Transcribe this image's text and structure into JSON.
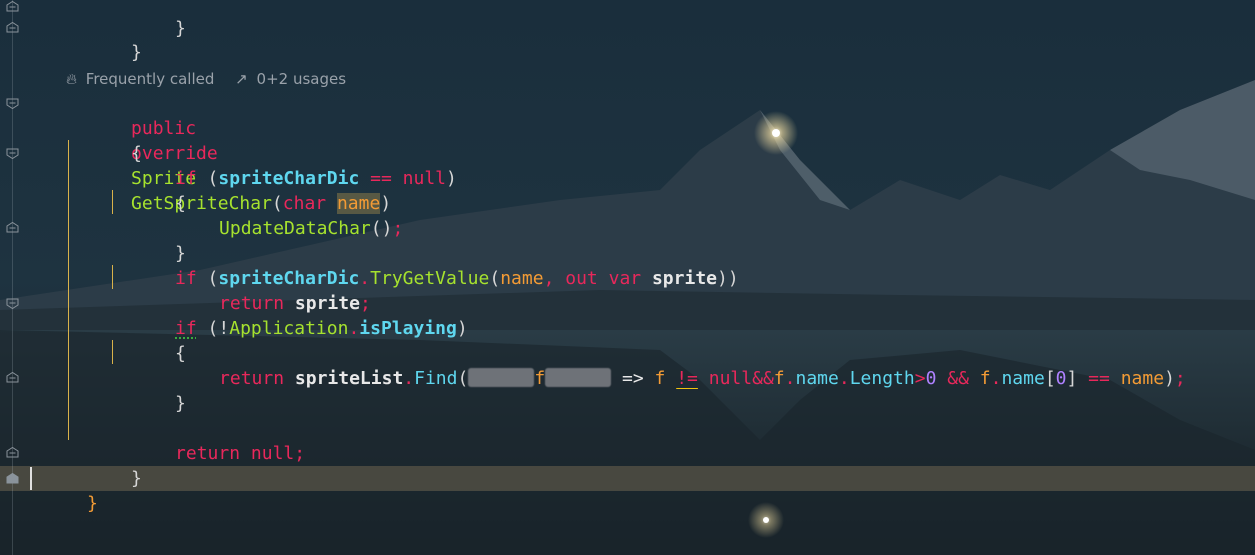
{
  "theme": {
    "keyword": "#e8285b",
    "type": "#a6e22e",
    "parameter": "#f39b35",
    "field": "#5fd7ef",
    "number": "#ae81ff",
    "guide": "#d9b24a"
  },
  "hint": {
    "frequently_called_icon": "flame-icon",
    "frequently_called": "Frequently called",
    "usages_icon": "external-link-icon",
    "usages": "0+2 usages"
  },
  "code": {
    "l0_brace": "}",
    "l1_brace": "}",
    "sig_public": "public",
    "sig_override": "override",
    "sig_type": "Sprite",
    "sig_name": "GetSpriteChar",
    "sig_open": "(",
    "sig_char": "char",
    "sig_param": "name",
    "sig_close": ")",
    "open_brace": "{",
    "if1_kw": "if",
    "if1_open": " (",
    "if1_field": "spriteCharDic",
    "if1_eq": " == ",
    "if1_null": "null",
    "if1_close": ")",
    "b1_open": "{",
    "call_update": "UpdateDataChar",
    "call_update_args": "()",
    "semi": ";",
    "b1_close": "}",
    "if2_kw": "if",
    "if2_open": " (",
    "if2_field": "spriteCharDic",
    "dot": ".",
    "if2_method": "TryGetValue",
    "if2_paren": "(",
    "if2_arg1": "name",
    "comma": ", ",
    "if2_out": "out",
    "if2_var": "var",
    "if2_sprite": "sprite",
    "if2_close": "))",
    "ret1_kw": "return",
    "ret1_val": "sprite",
    "if3_kw": "if",
    "if3_open": " (!",
    "if3_class": "Application",
    "if3_prop": "isPlaying",
    "if3_close": ")",
    "b3_open": "{",
    "ret2_kw": "return",
    "ret2_list": "spriteList",
    "ret2_find": "Find",
    "ret2_paren": "(",
    "ret2_f1": "f",
    "ret2_arrow": " => ",
    "ret2_f2": "f",
    "ret2_neq": "!=",
    "ret2_null": "null",
    "ret2_and": "&&",
    "ret2_f3": "f",
    "ret2_name1": "name",
    "ret2_length": "Length",
    "ret2_gt": ">",
    "ret2_zero": "0",
    "ret2_and2": " && ",
    "ret2_f4": "f",
    "ret2_name2": "name",
    "ret2_br_open": "[",
    "ret2_idx": "0",
    "ret2_br_close": "]",
    "ret2_eq": " == ",
    "ret2_name3": "name",
    "ret2_end": ")",
    "b3_close": "}",
    "ret3_kw": "return",
    "ret3_null": "null",
    "close_brace": "}",
    "class_close": "}"
  }
}
